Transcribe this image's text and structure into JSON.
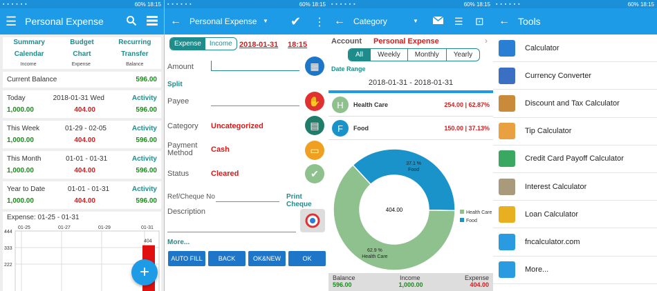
{
  "status_bar": {
    "time": "18:15",
    "battery": "60%"
  },
  "expense_home": {
    "title": "Personal Expense",
    "nav": [
      "Summary",
      "Budget",
      "Recurring",
      "Calendar",
      "Chart",
      "Transfer"
    ],
    "col_headers": [
      "Income",
      "Expense",
      "Balance"
    ],
    "current_balance_label": "Current Balance",
    "current_balance_value": "596.00",
    "periods": [
      {
        "label": "Today",
        "range": "2018-01-31 Wed",
        "activity": "Activity",
        "income": "1,000.00",
        "expense": "404.00",
        "balance": "596.00"
      },
      {
        "label": "This Week",
        "range": "01-29 - 02-05",
        "activity": "Activity",
        "income": "1,000.00",
        "expense": "404.00",
        "balance": "596.00"
      },
      {
        "label": "This Month",
        "range": "01-01 - 01-31",
        "activity": "Activity",
        "income": "1,000.00",
        "expense": "404.00",
        "balance": "596.00"
      },
      {
        "label": "Year to Date",
        "range": "01-01 - 01-31",
        "activity": "Activity",
        "income": "1,000.00",
        "expense": "404.00",
        "balance": "596.00"
      }
    ],
    "chart_title": "Expense: 01-25 - 01-31",
    "fab": "+"
  },
  "chart_data": {
    "type": "bar",
    "categories": [
      "01-25",
      "01-27",
      "01-29",
      "01-31"
    ],
    "values": [
      0,
      0,
      0,
      404
    ],
    "yticks": [
      "444",
      "333",
      "222"
    ],
    "value_label": "404",
    "ylim": [
      0,
      444
    ]
  },
  "add_expense": {
    "title": "Personal Expense",
    "seg": [
      "Expense",
      "Income"
    ],
    "date": "2018-01-31",
    "time": "18:15",
    "amount_label": "Amount",
    "split": "Split",
    "payee_label": "Payee",
    "category_label": "Category",
    "category_value": "Uncategorized",
    "payment_label": "Payment Method",
    "payment_value": "Cash",
    "status_label": "Status",
    "status_value": "Cleared",
    "ref_label": "Ref/Cheque No",
    "print_cheque": "Print Cheque",
    "description_label": "Description",
    "more": "More...",
    "buttons": [
      "AUTO FILL",
      "BACK",
      "OK&NEW",
      "OK"
    ]
  },
  "category": {
    "title": "Category",
    "account_label": "Account",
    "account_value": "Personal Expense",
    "seg": [
      "All",
      "Weekly",
      "Monthly",
      "Yearly"
    ],
    "date_range_label": "Date Range",
    "date_range": "2018-01-31 - 2018-01-31",
    "rows": [
      {
        "initial": "H",
        "name": "Health Care",
        "value": "254.00 | 62.87%",
        "color": "#8fc18f"
      },
      {
        "initial": "F",
        "name": "Food",
        "value": "150.00 | 37.13%",
        "color": "#1993c9"
      }
    ],
    "donut": {
      "center": "404.00",
      "slices": [
        {
          "label": "62.9 %",
          "name": "Health Care",
          "value": 62.87,
          "color": "#8fc18f"
        },
        {
          "label": "37.1 %",
          "name": "Food",
          "value": 37.13,
          "color": "#1993c9"
        }
      ]
    },
    "legend": [
      "Health Care",
      "Food"
    ],
    "footer": {
      "balance_label": "Balance",
      "income_label": "Income",
      "expense_label": "Expense",
      "balance": "596.00",
      "income": "1,000.00",
      "expense": "404.00"
    }
  },
  "tools": {
    "title": "Tools",
    "items": [
      {
        "label": "Calculator",
        "icon": "calculator-icon",
        "color": "#2a7fd4"
      },
      {
        "label": "Currency Converter",
        "icon": "currency-icon",
        "color": "#3a6fc4"
      },
      {
        "label": "Discount and Tax Calculator",
        "icon": "discount-icon",
        "color": "#c98a3a"
      },
      {
        "label": "Tip Calculator",
        "icon": "tip-icon",
        "color": "#e8a040"
      },
      {
        "label": "Credit Card Payoff Calculator",
        "icon": "credit-card-icon",
        "color": "#3aa860"
      },
      {
        "label": "Interest Calculator",
        "icon": "bank-icon",
        "color": "#a89a7a"
      },
      {
        "label": "Loan Calculator",
        "icon": "house-icon",
        "color": "#e8b020"
      },
      {
        "label": "fncalculator.com",
        "icon": "web-calculator-icon",
        "color": "#2a9be0"
      },
      {
        "label": "More...",
        "icon": "more-calculator-icon",
        "color": "#2a9be0"
      }
    ]
  }
}
